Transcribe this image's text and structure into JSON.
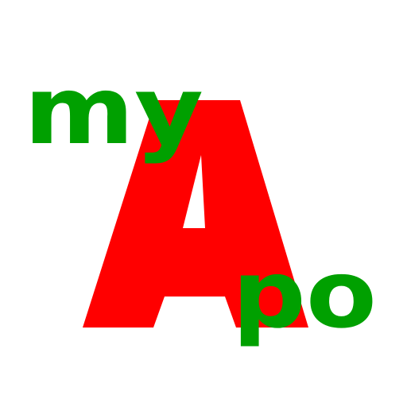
{
  "logo": {
    "text_my": "my",
    "text_a": "A",
    "text_po": "po"
  },
  "colors": {
    "background": "#ffffff",
    "a_red": "#ff0000",
    "green": "#00a000"
  }
}
